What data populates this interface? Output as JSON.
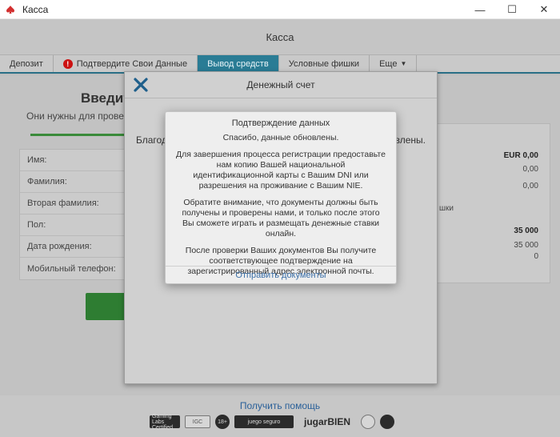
{
  "window": {
    "title": "Касса",
    "minimize": "—",
    "maximize": "☐",
    "close": "✕"
  },
  "app": {
    "header_title": "Касса",
    "tabs": [
      {
        "label": "Депозит"
      },
      {
        "label": "Подтвердите Свои Данные"
      },
      {
        "label": "Вывод средств"
      },
      {
        "label": "Условные фишки"
      },
      {
        "label": "Еще"
      }
    ]
  },
  "left": {
    "heading_fragment": "Введите",
    "subtitle_fragment": "Они нужны для проверки",
    "fields": [
      {
        "label": "Имя:"
      },
      {
        "label": "Фамилия:"
      },
      {
        "label": "Вторая фамилия:"
      },
      {
        "label": "Пол:"
      },
      {
        "label": "Дата рождения:"
      },
      {
        "label": "Мобильный телефон:"
      }
    ]
  },
  "right": {
    "balance_total": "EUR 0,00",
    "balance_1": "0,00",
    "balance_2": "0,00",
    "label_fragment": "шки",
    "points_total": "35 000",
    "points_1": "35 000",
    "points_2": "0"
  },
  "mid_modal": {
    "title": "Денежный счет",
    "text_left": "Благода",
    "text_right": "овлены."
  },
  "dialog": {
    "title": "Подтверждение данных",
    "p1": "Спасибо, данные обновлены.",
    "p2": "Для завершения процесса регистрации предоставьте нам копию Вашей национальной идентификационной карты с Вашим DNI или разрешения на проживание с Вашим NIE.",
    "p3": "Обратите внимание, что документы должны быть получены и проверены нами, и только после этого Вы сможете играть и размещать денежные ставки онлайн.",
    "p4": "После проверки Ваших документов Вы получите соответствующее подтверждение на зарегистрированный адрес электронной почты.",
    "action": "Отправить документы"
  },
  "footer": {
    "help": "Получить помощь",
    "logos": [
      "Gaming Labs Certified",
      "IGC",
      "18+",
      "juego seguro",
      "jugarBIEN"
    ]
  }
}
